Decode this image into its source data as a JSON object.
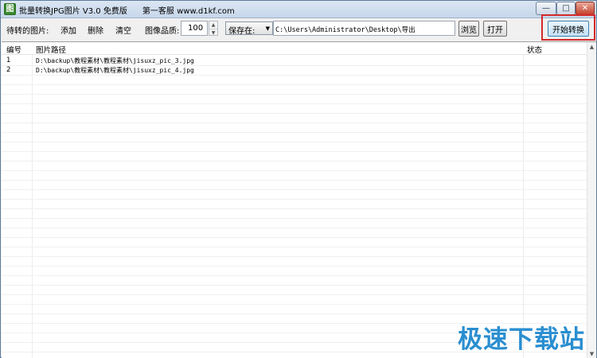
{
  "window": {
    "app_icon": "图",
    "title": "批量转换JPG图片 V3.0 免费版      第一客服 www.d1kf.com",
    "controls": {
      "minimize": "—",
      "maximize": "□",
      "close": "✕"
    }
  },
  "toolbar": {
    "pending_label": "待转的图片:",
    "add_label": "添加",
    "delete_label": "删除",
    "clear_label": "清空",
    "quality_label": "图像品质:",
    "quality_value": "100",
    "save_select": "保存在:",
    "save_path": "C:\\Users\\Administrator\\Desktop\\导出",
    "browse_label": "浏览",
    "open_label": "打开",
    "start_label": "开始转换"
  },
  "list": {
    "headers": {
      "num": "编号",
      "path": "图片路径",
      "status": "状态"
    },
    "rows": [
      {
        "num": "1",
        "path": "D:\\backup\\教程素材\\教程素材\\jisuxz_pic_3.jpg",
        "status": ""
      },
      {
        "num": "2",
        "path": "D:\\backup\\教程素材\\教程素材\\jisuxz_pic_4.jpg",
        "status": ""
      }
    ]
  },
  "watermark": "极速下载站"
}
